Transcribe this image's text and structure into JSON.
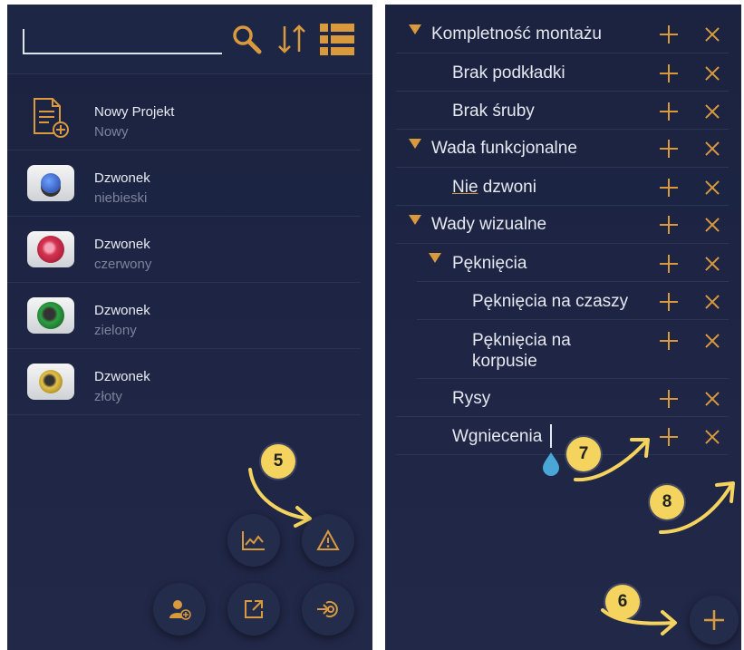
{
  "projects": [
    {
      "name": "Nowy Projekt",
      "sub": "Nowy",
      "icon": "new-document-icon"
    },
    {
      "name": "Dzwonek",
      "sub": "niebieski",
      "color": "#2f5fd0"
    },
    {
      "name": "Dzwonek",
      "sub": "czerwony",
      "color": "#d6334f"
    },
    {
      "name": "Dzwonek",
      "sub": "zielony",
      "color": "#2ea043"
    },
    {
      "name": "Dzwonek",
      "sub": "złoty",
      "color": "#c9a227"
    }
  ],
  "toolbar": {
    "search_icon": "search-icon",
    "sort_icon": "sort-icon",
    "list_icon": "list-view-icon"
  },
  "fabs": [
    "chart-icon",
    "warning-icon",
    "add-user-icon",
    "export-icon",
    "import-icon"
  ],
  "defects": [
    {
      "label": "Kompletność montażu",
      "level": 0,
      "expanded": true
    },
    {
      "label": "Brak podkładki",
      "level": 1
    },
    {
      "label": "Brak śruby",
      "level": 1
    },
    {
      "label": "Wada funkcjonalne",
      "level": 0,
      "expanded": true
    },
    {
      "label_underlined": "Nie",
      "label_rest": " dzwoni",
      "level": 1
    },
    {
      "label": "Wady wizualne",
      "level": 0,
      "expanded": true
    },
    {
      "label": "Pęknięcia",
      "level": 1,
      "expanded": true
    },
    {
      "label": "Pęknięcia na czaszy",
      "level": 2
    },
    {
      "label": "Pęknięcia na korpusie",
      "level": 2
    },
    {
      "label": "Rysy",
      "level": 1
    },
    {
      "label": "Wgniecenia",
      "level": 1,
      "editing": true
    }
  ],
  "annotations": [
    "5",
    "6",
    "7",
    "8"
  ],
  "colors": {
    "accent": "#d99a3e",
    "background": "#1d2444",
    "badge": "#f4d35e"
  }
}
